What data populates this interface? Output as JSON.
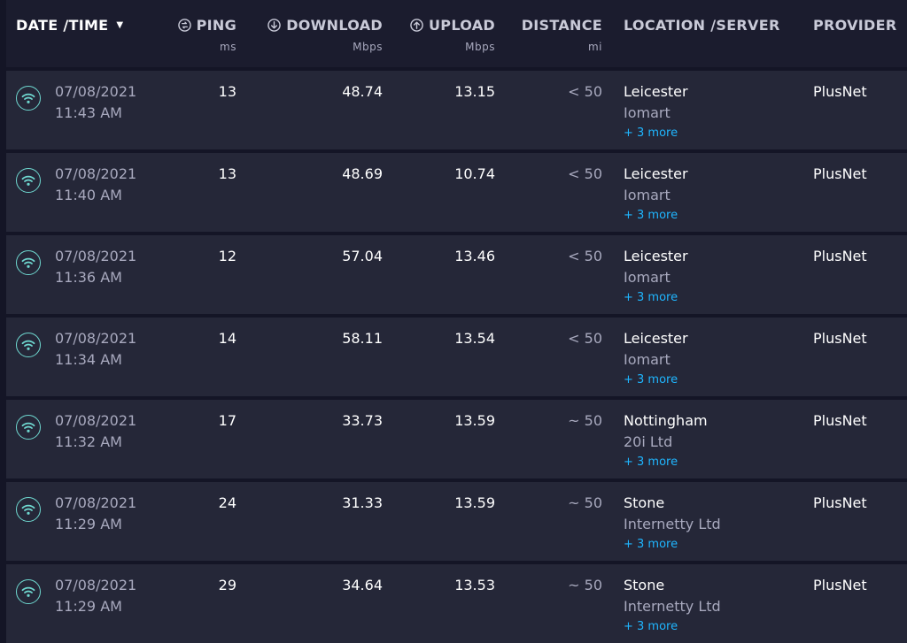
{
  "header": {
    "datetime": "DATE /TIME",
    "ping": "PING",
    "ping_unit": "ms",
    "download": "DOWNLOAD",
    "download_unit": "Mbps",
    "upload": "UPLOAD",
    "upload_unit": "Mbps",
    "distance": "DISTANCE",
    "distance_unit": "mi",
    "location": "LOCATION /SERVER",
    "provider": "PROVIDER",
    "sort_icon": "caret-down-icon",
    "ping_icon": "ping-icon",
    "download_icon": "download-arrow-icon",
    "upload_icon": "upload-arrow-icon"
  },
  "colors": {
    "background": "#141526",
    "row": "#252738",
    "header": "#1b1c2e",
    "accent_wifi": "#6fd8d0",
    "link": "#1fb6ff",
    "muted": "#a8a9be"
  },
  "results": [
    {
      "date": "07/08/2021",
      "time": "11:43 AM",
      "ping": "13",
      "download": "48.74",
      "upload": "13.15",
      "distance": "< 50",
      "city": "Leicester",
      "sponsor": "Iomart",
      "more": "+ 3 more",
      "provider": "PlusNet",
      "icon": "wifi-icon"
    },
    {
      "date": "07/08/2021",
      "time": "11:40 AM",
      "ping": "13",
      "download": "48.69",
      "upload": "10.74",
      "distance": "< 50",
      "city": "Leicester",
      "sponsor": "Iomart",
      "more": "+ 3 more",
      "provider": "PlusNet",
      "icon": "wifi-icon"
    },
    {
      "date": "07/08/2021",
      "time": "11:36 AM",
      "ping": "12",
      "download": "57.04",
      "upload": "13.46",
      "distance": "< 50",
      "city": "Leicester",
      "sponsor": "Iomart",
      "more": "+ 3 more",
      "provider": "PlusNet",
      "icon": "wifi-icon"
    },
    {
      "date": "07/08/2021",
      "time": "11:34 AM",
      "ping": "14",
      "download": "58.11",
      "upload": "13.54",
      "distance": "< 50",
      "city": "Leicester",
      "sponsor": "Iomart",
      "more": "+ 3 more",
      "provider": "PlusNet",
      "icon": "wifi-icon"
    },
    {
      "date": "07/08/2021",
      "time": "11:32 AM",
      "ping": "17",
      "download": "33.73",
      "upload": "13.59",
      "distance": "~ 50",
      "city": "Nottingham",
      "sponsor": "20i Ltd",
      "more": "+ 3 more",
      "provider": "PlusNet",
      "icon": "wifi-icon"
    },
    {
      "date": "07/08/2021",
      "time": "11:29 AM",
      "ping": "24",
      "download": "31.33",
      "upload": "13.59",
      "distance": "~ 50",
      "city": "Stone",
      "sponsor": "Internetty Ltd",
      "more": "+ 3 more",
      "provider": "PlusNet",
      "icon": "wifi-icon"
    },
    {
      "date": "07/08/2021",
      "time": "11:29 AM",
      "ping": "29",
      "download": "34.64",
      "upload": "13.53",
      "distance": "~ 50",
      "city": "Stone",
      "sponsor": "Internetty Ltd",
      "more": "+ 3 more",
      "provider": "PlusNet",
      "icon": "wifi-icon"
    }
  ]
}
